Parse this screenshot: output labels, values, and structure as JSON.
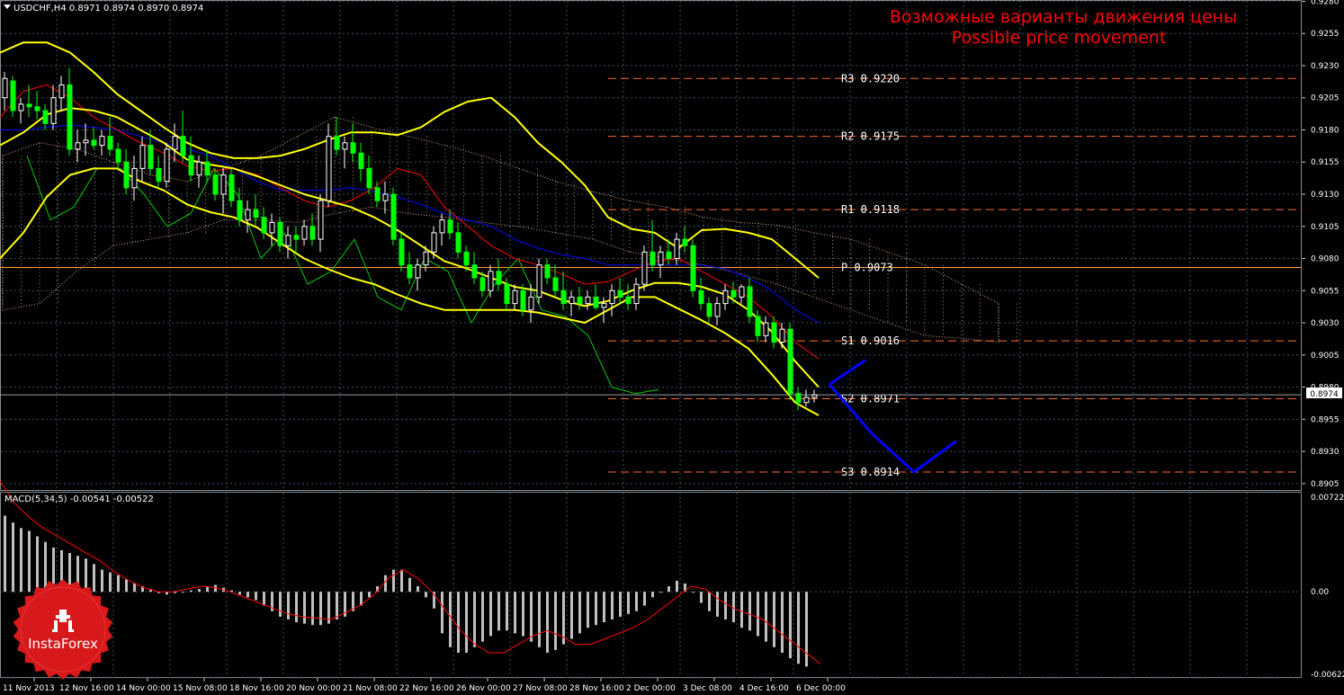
{
  "header": {
    "symbol_line": "USDCHF,H4  0.8971 0.8974 0.8970 0.8974",
    "title_ru": "Возможные варианты движения цены",
    "title_en": "Possible price movement"
  },
  "macd_header": "MACD(5,34,5) -0.00541 -0.00522",
  "current_price_label": "0.8974",
  "brand": {
    "name": "InstaForex",
    "color": "#d7191b"
  },
  "colors": {
    "bull": "#ffffff",
    "bear": "#00ff00",
    "bands": "#ffff00",
    "red_line": "#ff0000",
    "blue_line": "#0000ff",
    "green_line": "#00cc00",
    "pivot_dash": "#ff6a2a",
    "pivot_solid": "#ff9a3a",
    "title": "#ff0000",
    "grid": "#3a5060",
    "text": "#ffffff"
  },
  "chart_data": [
    {
      "type": "candlestick",
      "title": "USDCHF,H4",
      "y_ticks": [
        "0.9280",
        "0.9255",
        "0.9230",
        "0.9205",
        "0.9180",
        "0.9155",
        "0.9130",
        "0.9105",
        "0.9080",
        "0.9055",
        "0.9030",
        "0.9005",
        "0.8980",
        "0.8955",
        "0.8930",
        "0.8905"
      ],
      "ylim": [
        0.89,
        0.9281
      ],
      "x_labels": [
        "11 Nov 2013",
        "12 Nov 16:00",
        "14 Nov 00:00",
        "15 Nov 08:00",
        "18 Nov 16:00",
        "20 Nov 00:00",
        "21 Nov 08:00",
        "22 Nov 16:00",
        "26 Nov 00:00",
        "27 Nov 08:00",
        "28 Nov 16:00",
        "2 Dec 00:00",
        "3 Dec 08:00",
        "4 Dec 16:00",
        "6 Dec 00:00"
      ],
      "pivot_levels": [
        {
          "name": "R3",
          "value": 0.922,
          "label": "R3  0.9220",
          "style": "dash"
        },
        {
          "name": "R2",
          "value": 0.9175,
          "label": "R2  0.9175",
          "style": "dash"
        },
        {
          "name": "R1",
          "value": 0.9118,
          "label": "R1  0.9118",
          "style": "dash"
        },
        {
          "name": "P",
          "value": 0.9073,
          "label": "P  0.9073",
          "style": "solid"
        },
        {
          "name": "S1",
          "value": 0.9016,
          "label": "S1  0.9016",
          "style": "dash"
        },
        {
          "name": "S2",
          "value": 0.8971,
          "label": "S2  0.8971",
          "style": "dash"
        },
        {
          "name": "S3",
          "value": 0.8914,
          "label": "S3  0.8914",
          "style": "dash"
        }
      ],
      "last_price": 0.8974,
      "ohlc": [
        [
          0.9205,
          0.9225,
          0.9195,
          0.922
        ],
        [
          0.9218,
          0.9222,
          0.919,
          0.9195
        ],
        [
          0.9195,
          0.9205,
          0.9185,
          0.92
        ],
        [
          0.92,
          0.9215,
          0.919,
          0.9198
        ],
        [
          0.9198,
          0.921,
          0.9188,
          0.9195
        ],
        [
          0.9195,
          0.92,
          0.918,
          0.9185
        ],
        [
          0.9185,
          0.9215,
          0.918,
          0.9205
        ],
        [
          0.9205,
          0.9222,
          0.9195,
          0.9215
        ],
        [
          0.9215,
          0.9228,
          0.916,
          0.9165
        ],
        [
          0.9165,
          0.918,
          0.9155,
          0.917
        ],
        [
          0.917,
          0.9185,
          0.916,
          0.9172
        ],
        [
          0.9172,
          0.9182,
          0.9165,
          0.9168
        ],
        [
          0.9168,
          0.918,
          0.916,
          0.9175
        ],
        [
          0.9175,
          0.919,
          0.916,
          0.9165
        ],
        [
          0.9165,
          0.917,
          0.915,
          0.9155
        ],
        [
          0.9155,
          0.9165,
          0.913,
          0.9135
        ],
        [
          0.9135,
          0.916,
          0.9125,
          0.915
        ],
        [
          0.915,
          0.9175,
          0.914,
          0.9168
        ],
        [
          0.9168,
          0.918,
          0.9145,
          0.915
        ],
        [
          0.915,
          0.916,
          0.9135,
          0.914
        ],
        [
          0.914,
          0.917,
          0.9135,
          0.9165
        ],
        [
          0.9165,
          0.9185,
          0.9155,
          0.9175
        ],
        [
          0.9175,
          0.9195,
          0.9155,
          0.916
        ],
        [
          0.916,
          0.9175,
          0.914,
          0.9145
        ],
        [
          0.9145,
          0.916,
          0.9135,
          0.9155
        ],
        [
          0.9155,
          0.9165,
          0.914,
          0.9145
        ],
        [
          0.9145,
          0.915,
          0.9125,
          0.913
        ],
        [
          0.913,
          0.915,
          0.9115,
          0.9145
        ],
        [
          0.9145,
          0.915,
          0.912,
          0.9125
        ],
        [
          0.9125,
          0.9135,
          0.9105,
          0.911
        ],
        [
          0.911,
          0.9125,
          0.91,
          0.9118
        ],
        [
          0.9118,
          0.913,
          0.9105,
          0.9112
        ],
        [
          0.9112,
          0.912,
          0.9095,
          0.91
        ],
        [
          0.91,
          0.9115,
          0.909,
          0.9108
        ],
        [
          0.9108,
          0.9112,
          0.9085,
          0.909
        ],
        [
          0.909,
          0.9105,
          0.908,
          0.9098
        ],
        [
          0.9098,
          0.9105,
          0.9085,
          0.9095
        ],
        [
          0.9095,
          0.911,
          0.909,
          0.9105
        ],
        [
          0.9105,
          0.9115,
          0.909,
          0.9095
        ],
        [
          0.9095,
          0.913,
          0.9085,
          0.9125
        ],
        [
          0.9125,
          0.9185,
          0.912,
          0.9175
        ],
        [
          0.9175,
          0.919,
          0.916,
          0.9165
        ],
        [
          0.9165,
          0.9175,
          0.915,
          0.917
        ],
        [
          0.917,
          0.9185,
          0.9155,
          0.9162
        ],
        [
          0.9162,
          0.917,
          0.914,
          0.915
        ],
        [
          0.915,
          0.916,
          0.913,
          0.9135
        ],
        [
          0.9135,
          0.914,
          0.912,
          0.9125
        ],
        [
          0.9125,
          0.914,
          0.9115,
          0.913
        ],
        [
          0.913,
          0.9135,
          0.909,
          0.9095
        ],
        [
          0.9095,
          0.91,
          0.907,
          0.9075
        ],
        [
          0.9075,
          0.9085,
          0.906,
          0.9065
        ],
        [
          0.9065,
          0.908,
          0.9055,
          0.9075
        ],
        [
          0.9075,
          0.909,
          0.907,
          0.9085
        ],
        [
          0.9085,
          0.9105,
          0.908,
          0.91
        ],
        [
          0.91,
          0.9115,
          0.909,
          0.911
        ],
        [
          0.911,
          0.9118,
          0.9095,
          0.91
        ],
        [
          0.91,
          0.9108,
          0.908,
          0.9085
        ],
        [
          0.9085,
          0.909,
          0.907,
          0.9075
        ],
        [
          0.9075,
          0.9085,
          0.906,
          0.9065
        ],
        [
          0.9065,
          0.907,
          0.905,
          0.9055
        ],
        [
          0.9055,
          0.9075,
          0.905,
          0.907
        ],
        [
          0.907,
          0.908,
          0.9055,
          0.906
        ],
        [
          0.906,
          0.9065,
          0.904,
          0.9045
        ],
        [
          0.9045,
          0.906,
          0.904,
          0.9055
        ],
        [
          0.9055,
          0.906,
          0.9035,
          0.904
        ],
        [
          0.904,
          0.906,
          0.903,
          0.905
        ],
        [
          0.905,
          0.908,
          0.9045,
          0.9075
        ],
        [
          0.9075,
          0.908,
          0.906,
          0.9065
        ],
        [
          0.9065,
          0.9075,
          0.905,
          0.9055
        ],
        [
          0.9055,
          0.907,
          0.904,
          0.9045
        ],
        [
          0.9045,
          0.9055,
          0.9035,
          0.905
        ],
        [
          0.905,
          0.9058,
          0.904,
          0.9045
        ],
        [
          0.9045,
          0.9055,
          0.904,
          0.905
        ],
        [
          0.905,
          0.906,
          0.904,
          0.9042
        ],
        [
          0.9042,
          0.905,
          0.903,
          0.9045
        ],
        [
          0.9045,
          0.906,
          0.9035,
          0.9055
        ],
        [
          0.9055,
          0.9065,
          0.9045,
          0.905
        ],
        [
          0.905,
          0.906,
          0.904,
          0.9045
        ],
        [
          0.9045,
          0.9065,
          0.904,
          0.906
        ],
        [
          0.906,
          0.909,
          0.9055,
          0.9085
        ],
        [
          0.9085,
          0.911,
          0.907,
          0.9075
        ],
        [
          0.9075,
          0.909,
          0.9065,
          0.9085
        ],
        [
          0.9085,
          0.9095,
          0.9075,
          0.908
        ],
        [
          0.908,
          0.91,
          0.9075,
          0.9095
        ],
        [
          0.9095,
          0.9105,
          0.9085,
          0.909
        ],
        [
          0.909,
          0.9095,
          0.905,
          0.9055
        ],
        [
          0.9055,
          0.9065,
          0.904,
          0.9045
        ],
        [
          0.9045,
          0.905,
          0.903,
          0.9035
        ],
        [
          0.9035,
          0.905,
          0.9028,
          0.9045
        ],
        [
          0.9045,
          0.906,
          0.904,
          0.9055
        ],
        [
          0.9055,
          0.9062,
          0.9045,
          0.905
        ],
        [
          0.905,
          0.906,
          0.9045,
          0.9058
        ],
        [
          0.9058,
          0.9065,
          0.903,
          0.9035
        ],
        [
          0.9035,
          0.904,
          0.9015,
          0.902
        ],
        [
          0.902,
          0.9035,
          0.9015,
          0.903
        ],
        [
          0.903,
          0.9035,
          0.901,
          0.9015
        ],
        [
          0.9015,
          0.903,
          0.901,
          0.9025
        ],
        [
          0.9025,
          0.903,
          0.897,
          0.8975
        ],
        [
          0.8975,
          0.898,
          0.8962,
          0.8968
        ],
        [
          0.8968,
          0.8978,
          0.8965,
          0.8972
        ],
        [
          0.8972,
          0.8978,
          0.8968,
          0.8974
        ]
      ],
      "bollinger_upper": [
        0.924,
        0.9248,
        0.9248,
        0.924,
        0.9225,
        0.9208,
        0.9195,
        0.9182,
        0.917,
        0.9162,
        0.9158,
        0.9158,
        0.916,
        0.9165,
        0.9172,
        0.9178,
        0.9178,
        0.9176,
        0.9182,
        0.9194,
        0.9202,
        0.9205,
        0.919,
        0.917,
        0.9155,
        0.9137,
        0.9112,
        0.9103,
        0.91,
        0.9088,
        0.9102,
        0.9103,
        0.91,
        0.9095,
        0.908,
        0.9065
      ],
      "bollinger_middle": [
        0.9168,
        0.9178,
        0.9192,
        0.9197,
        0.9195,
        0.919,
        0.918,
        0.917,
        0.9157,
        0.9153,
        0.915,
        0.9144,
        0.9137,
        0.913,
        0.9125,
        0.912,
        0.9112,
        0.9102,
        0.909,
        0.9078,
        0.9072,
        0.9065,
        0.9058,
        0.9055,
        0.9048,
        0.9043,
        0.9047,
        0.9055,
        0.9061,
        0.9061,
        0.9058,
        0.9052,
        0.904,
        0.9023,
        0.9,
        0.898
      ],
      "bollinger_lower": [
        0.908,
        0.91,
        0.9128,
        0.9145,
        0.915,
        0.915,
        0.914,
        0.9133,
        0.9122,
        0.9116,
        0.9112,
        0.9104,
        0.9092,
        0.908,
        0.9072,
        0.9065,
        0.906,
        0.9052,
        0.9045,
        0.904,
        0.904,
        0.904,
        0.904,
        0.9038,
        0.9034,
        0.903,
        0.904,
        0.905,
        0.905,
        0.9041,
        0.9032,
        0.9022,
        0.901,
        0.899,
        0.8968,
        0.8958
      ],
      "red_line": [
        0.919,
        0.921,
        0.9215,
        0.9205,
        0.919,
        0.918,
        0.917,
        0.9162,
        0.9152,
        0.9148,
        0.915,
        0.9145,
        0.9135,
        0.9125,
        0.912,
        0.9125,
        0.9135,
        0.915,
        0.9145,
        0.912,
        0.9105,
        0.909,
        0.908,
        0.9075,
        0.9068,
        0.906,
        0.9062,
        0.907,
        0.9078,
        0.908,
        0.907,
        0.906,
        0.905,
        0.9035,
        0.9015,
        0.9002
      ],
      "blue_line": [
        0.918,
        0.918,
        0.9182,
        0.9184,
        0.9182,
        0.918,
        0.9175,
        0.917,
        0.9165,
        0.916,
        0.915,
        0.914,
        0.9133,
        0.9133,
        0.9133,
        0.9135,
        0.9132,
        0.9128,
        0.9122,
        0.9115,
        0.911,
        0.9105,
        0.9095,
        0.9088,
        0.9083,
        0.908,
        0.9075,
        0.9075,
        0.9075,
        0.9075,
        0.9075,
        0.9072,
        0.9065,
        0.9055,
        0.904,
        0.903
      ],
      "green_line": [
        0.916,
        0.911,
        0.912,
        0.915,
        0.915,
        0.913,
        0.9105,
        0.9115,
        0.915,
        0.913,
        0.908,
        0.91,
        0.906,
        0.907,
        0.9095,
        0.905,
        0.904,
        0.908,
        0.907,
        0.903,
        0.906,
        0.908,
        0.904,
        0.9035,
        0.902,
        0.898,
        0.8975,
        0.8978
      ],
      "cloud_upper": [
        0.916,
        0.917,
        0.9165,
        0.9155,
        0.9145,
        0.914,
        0.915,
        0.916,
        0.9175,
        0.919,
        0.9182,
        0.9175,
        0.9168,
        0.916,
        0.915,
        0.914,
        0.9132,
        0.9125,
        0.912,
        0.9112,
        0.9108,
        0.9106,
        0.91,
        0.9095,
        0.9085,
        0.9075,
        0.906,
        0.9045
      ],
      "cloud_lower": [
        0.904,
        0.9045,
        0.907,
        0.909,
        0.9095,
        0.91,
        0.911,
        0.911,
        0.9108,
        0.9115,
        0.912,
        0.9115,
        0.9112,
        0.9108,
        0.9105,
        0.91,
        0.9095,
        0.9085,
        0.908,
        0.9075,
        0.9068,
        0.906,
        0.905,
        0.904,
        0.903,
        0.902,
        0.9018,
        0.9015
      ],
      "forecast_paths": [
        {
          "name": "up",
          "points": [
            0.8982,
            0.9001
          ]
        },
        {
          "name": "down",
          "points": [
            0.8982,
            0.8944,
            0.8914,
            0.8938
          ]
        }
      ]
    },
    {
      "type": "histogram",
      "title": "MACD(5,34,5)",
      "y_ticks": [
        "0.00722",
        "0.00",
        "-0.00622"
      ],
      "ylim": [
        -0.00622,
        0.00722
      ],
      "histogram": [
        0.0055,
        0.005,
        0.0046,
        0.0044,
        0.004,
        0.0036,
        0.0032,
        0.003,
        0.0028,
        0.0026,
        0.0024,
        0.002,
        0.0016,
        0.0014,
        0.0012,
        0.0009,
        0.0006,
        0.0004,
        0.0002,
        -0.0001,
        -0.0002,
        -0.0001,
        0.0,
        0.0001,
        0.0002,
        0.0004,
        0.0005,
        0.0003,
        0.0001,
        -0.0002,
        -0.0004,
        -0.0006,
        -0.001,
        -0.0014,
        -0.0018,
        -0.002,
        -0.0022,
        -0.0023,
        -0.0024,
        -0.0024,
        -0.0023,
        -0.002,
        -0.0018,
        -0.0014,
        -0.001,
        -0.0004,
        0.0004,
        0.0012,
        0.0016,
        0.0016,
        0.001,
        0.0004,
        -0.0004,
        -0.0012,
        -0.003,
        -0.004,
        -0.0044,
        -0.0044,
        -0.004,
        -0.0036,
        -0.0032,
        -0.0028,
        -0.0028,
        -0.003,
        -0.0032,
        -0.0036,
        -0.004,
        -0.0044,
        -0.0042,
        -0.0038,
        -0.0034,
        -0.003,
        -0.0026,
        -0.0024,
        -0.0022,
        -0.002,
        -0.0018,
        -0.0016,
        -0.0014,
        -0.001,
        -0.0004,
        0.0,
        0.0004,
        0.0008,
        0.0006,
        0.0,
        -0.0008,
        -0.0014,
        -0.0018,
        -0.002,
        -0.0022,
        -0.0026,
        -0.0028,
        -0.0032,
        -0.0036,
        -0.004,
        -0.0044,
        -0.0048,
        -0.0052,
        -0.0054
      ],
      "signal": [
        0.008,
        0.0064,
        0.0054,
        0.0046,
        0.004,
        0.0034,
        0.0028,
        0.0022,
        0.0014,
        0.0008,
        0.0003,
        0.0,
        0.0,
        0.0002,
        0.0004,
        0.0003,
        0.0,
        -0.0004,
        -0.0008,
        -0.0012,
        -0.0016,
        -0.0018,
        -0.0019,
        -0.002,
        -0.0015,
        -0.001,
        -0.0002,
        0.001,
        0.0016,
        0.001,
        0.0,
        -0.0014,
        -0.0028,
        -0.0038,
        -0.0044,
        -0.0044,
        -0.0038,
        -0.0032,
        -0.0028,
        -0.0032,
        -0.0038,
        -0.0038,
        -0.0034,
        -0.003,
        -0.0026,
        -0.002,
        -0.0012,
        -0.0004,
        0.0004,
        0.0002,
        -0.0006,
        -0.0012,
        -0.0016,
        -0.002,
        -0.0028,
        -0.0036,
        -0.0044,
        -0.0052
      ]
    }
  ]
}
